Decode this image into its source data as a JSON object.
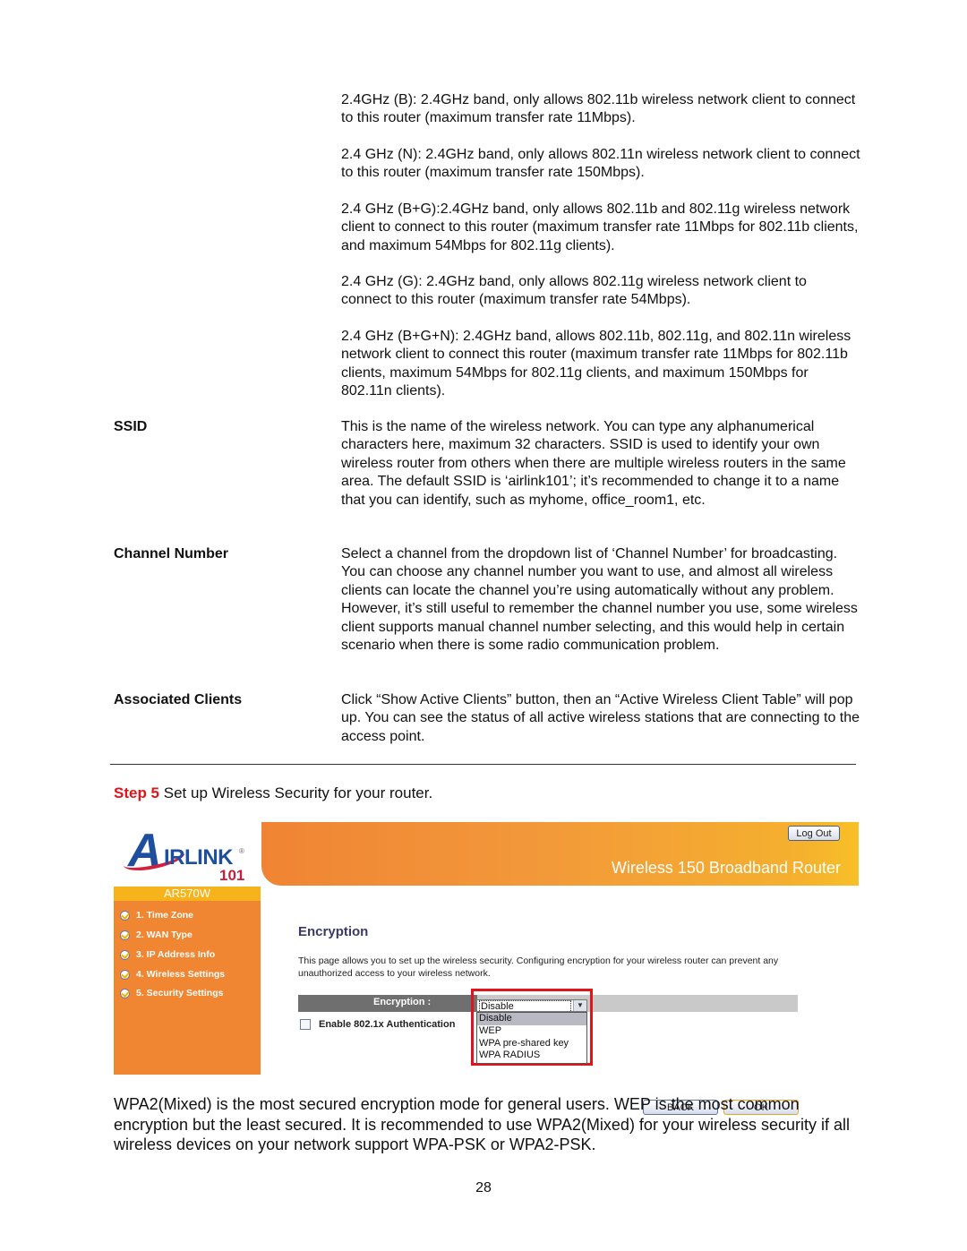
{
  "doc": {
    "band_paragraphs": [
      "2.4GHz (B): 2.4GHz band, only allows 802.11b wireless network client to connect to this router (maximum transfer rate 11Mbps).",
      "2.4 GHz (N): 2.4GHz band, only allows 802.11n wireless network client to connect to this router (maximum transfer rate 150Mbps).",
      "2.4 GHz (B+G):2.4GHz band, only allows 802.11b and 802.11g wireless network client to connect to this router (maximum transfer rate 11Mbps for 802.11b clients, and maximum 54Mbps for 802.11g clients).",
      "2.4 GHz (G): 2.4GHz band, only allows 802.11g wireless network client to connect to this router (maximum transfer rate 54Mbps).",
      "2.4 GHz (B+G+N): 2.4GHz band, allows 802.11b, 802.11g, and 802.11n wireless network client to connect this router (maximum transfer rate 11Mbps for 802.11b clients, maximum 54Mbps for 802.11g clients, and maximum 150Mbps for 802.11n clients)."
    ],
    "definitions": [
      {
        "term": "SSID",
        "text": "This is the name of the wireless network. You can type any alphanumerical characters here, maximum 32 characters. SSID is used to identify your own wireless router from others when there are multiple wireless routers in the same area. The default SSID is ‘airlink101’; it’s recommended to change it to a name that you can identify, such as myhome, office_room1, etc."
      },
      {
        "term": "Channel Number",
        "text": "Select a channel from the dropdown list of ‘Channel Number’ for broadcasting. You can choose any channel number you want to use, and almost all wireless clients can locate the channel you’re using automatically without any problem. However, it’s still useful to remember the channel number you use, some wireless client supports manual channel number selecting, and this would help in certain scenario when there is some radio communication problem."
      },
      {
        "term": "Associated Clients",
        "text": "Click “Show Active Clients” button, then an “Active Wireless Client Table” will pop up. You can see the status of all active wireless stations that are connecting to the access point."
      }
    ],
    "step": {
      "number_label": "Step 5",
      "text": " Set up Wireless Security for your router."
    },
    "closing_paragraph": "WPA2(Mixed) is the most secured encryption mode for general users. WEP is the most common encryption but the least secured. It is recommended to use WPA2(Mixed) for your wireless security if all wireless devices on your network support WPA-PSK or WPA2-PSK.",
    "page_number": "28"
  },
  "router_ui": {
    "logo": {
      "letter": "A",
      "text": "IRLINK",
      "registered": "®",
      "suffix": "101"
    },
    "model": "AR570W",
    "header_title": "Wireless 150 Broadband Router",
    "logout_label": "Log Out",
    "sidebar": [
      {
        "label": "1. Time Zone"
      },
      {
        "label": "2. WAN Type"
      },
      {
        "label": "3. IP Address Info"
      },
      {
        "label": "4. Wireless Settings"
      },
      {
        "label": "5. Security Settings"
      }
    ],
    "page_title": "Encryption",
    "page_description": "This page allows you to set up the wireless security. Configuring encryption for your wireless router can prevent any unauthorized access to your wireless network.",
    "encryption_label": "Encryption :",
    "encryption_value": "Disable",
    "encryption_options": [
      "Disable",
      "WEP",
      "WPA pre-shared key",
      "WPA RADIUS"
    ],
    "auth_checkbox_label": "Enable 802.1x Authentication",
    "auth_checked": false,
    "back_label": "BACK",
    "ok_label": "OK",
    "colors": {
      "highlight_red": "#e1141b",
      "sidebar_orange": "#f08631",
      "model_bar": "#f6b31c"
    }
  }
}
